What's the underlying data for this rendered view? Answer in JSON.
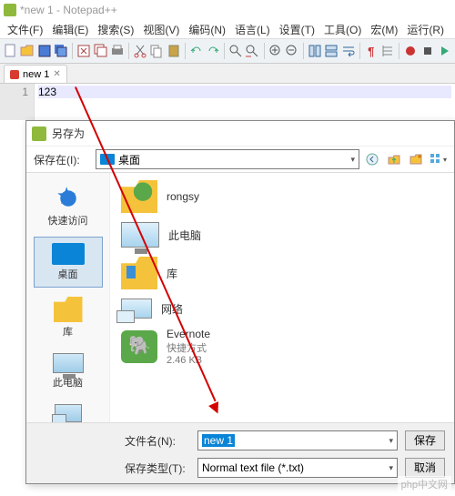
{
  "window": {
    "title": "*new 1 - Notepad++"
  },
  "menu": {
    "file": "文件(F)",
    "edit": "编辑(E)",
    "search": "搜索(S)",
    "view": "视图(V)",
    "encoding": "编码(N)",
    "language": "语言(L)",
    "settings": "设置(T)",
    "tools": "工具(O)",
    "macro": "宏(M)",
    "run": "运行(R)"
  },
  "tab": {
    "name": "new 1"
  },
  "editor": {
    "line1_num": "1",
    "line1_text": "123"
  },
  "dialog": {
    "title": "另存为",
    "save_in_label": "保存在(I):",
    "save_in_value": "桌面",
    "places": {
      "quick": "快速访问",
      "desktop": "桌面",
      "lib": "库",
      "pc": "此电脑",
      "net": "网络"
    },
    "items": {
      "rongsy": "rongsy",
      "thispc": "此电脑",
      "lib": "库",
      "net": "网络",
      "evernote": "Evernote",
      "evernote_sub1": "快捷方式",
      "evernote_sub2": "2.46 KB"
    },
    "filename_label": "文件名(N):",
    "filename_value": "new 1",
    "filetype_label": "保存类型(T):",
    "filetype_value": "Normal text file (*.txt)",
    "save_btn": "保存",
    "cancel_btn": "取消"
  },
  "watermark": "php中文网"
}
